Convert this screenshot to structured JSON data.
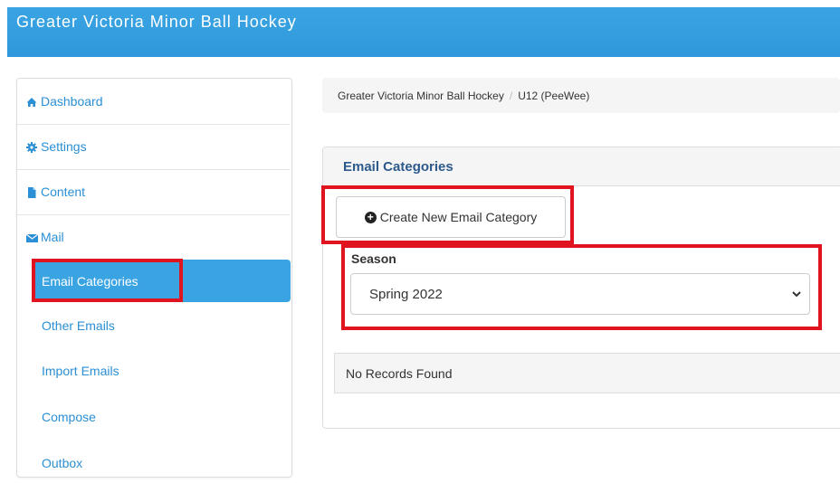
{
  "header": {
    "title": "Greater Victoria Minor Ball Hockey"
  },
  "sidebar": {
    "items": [
      {
        "label": "Dashboard",
        "icon": "home-icon"
      },
      {
        "label": "Settings",
        "icon": "gear-icon"
      },
      {
        "label": "Content",
        "icon": "file-icon"
      },
      {
        "label": "Mail",
        "icon": "envelope-icon"
      }
    ],
    "mail_submenu": [
      {
        "label": "Email Categories",
        "active": true
      },
      {
        "label": "Other Emails",
        "active": false
      },
      {
        "label": "Import Emails",
        "active": false
      },
      {
        "label": "Compose",
        "active": false
      },
      {
        "label": "Outbox",
        "active": false
      }
    ]
  },
  "breadcrumb": [
    "Greater Victoria Minor Ball Hockey",
    "U12 (PeeWee)"
  ],
  "breadcrumb_separator": "/",
  "panel": {
    "title": "Email Categories",
    "create_button_label": "Create New Email Category",
    "season_label": "Season",
    "season_value": "Spring 2022",
    "empty_message": "No Records Found"
  },
  "colors": {
    "header_bg": "#3aa4e3",
    "link": "#2a8fd4",
    "active_item_bg": "#3aa4e3",
    "panel_title": "#2c5a8c",
    "highlight": "#e0141e"
  }
}
